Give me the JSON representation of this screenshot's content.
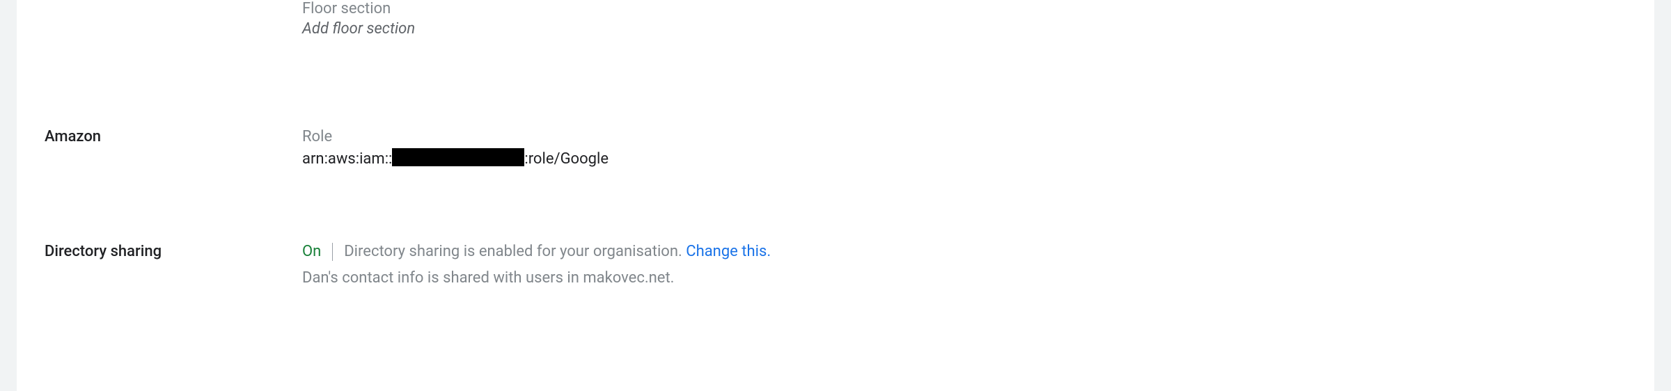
{
  "floor_section": {
    "label": "Floor section",
    "add_text": "Add floor section"
  },
  "amazon": {
    "section_label": "Amazon",
    "field_label": "Role",
    "arn_prefix": "arn:aws:iam::",
    "arn_suffix": ":role/Google"
  },
  "directory_sharing": {
    "section_label": "Directory sharing",
    "status": "On",
    "description": "Directory sharing is enabled for your organisation. ",
    "change_link": "Change this.",
    "sub_description": "Dan's contact info is shared with users in makovec.net."
  }
}
